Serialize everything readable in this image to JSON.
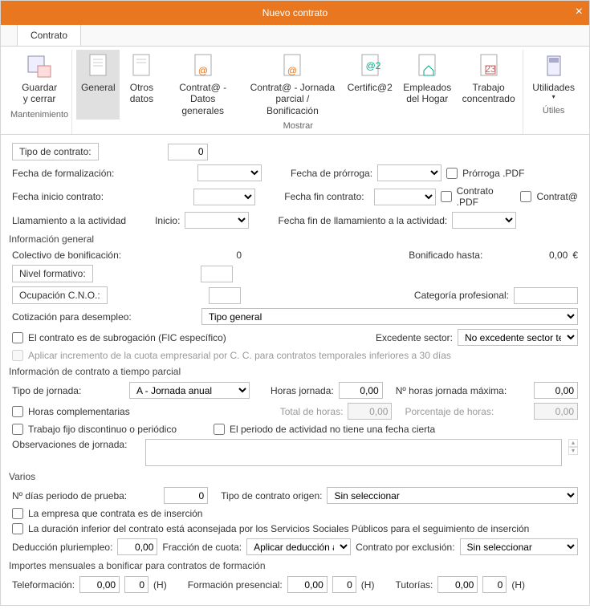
{
  "title": "Nuevo contrato",
  "tab": "Contrato",
  "ribbon": {
    "g1": {
      "label": "Mantenimiento",
      "b1": "Guardar\ny cerrar"
    },
    "g2": {
      "label": "Mostrar",
      "b1": "General",
      "b2": "Otros\ndatos",
      "b3": "Contrat@ -\nDatos generales",
      "b4": "Contrat@ - Jornada\nparcial / Bonificación",
      "b5": "Certific@2",
      "b6": "Empleados\ndel Hogar",
      "b7": "Trabajo\nconcentrado"
    },
    "g3": {
      "label": "Útiles",
      "b1": "Utilidades"
    }
  },
  "f": {
    "tipo_contrato_l": "Tipo de contrato:",
    "tipo_contrato_v": "0",
    "fecha_form_l": "Fecha de formalización:",
    "fecha_ini_l": "Fecha inicio contrato:",
    "llam_l": "Llamamiento a la actividad",
    "inicio_l": "Inicio:",
    "fecha_pro_l": "Fecha de prórroga:",
    "prorroga_pdf": "Prórroga .PDF",
    "fecha_fin_l": "Fecha fin contrato:",
    "contrato_pdf": "Contrato .PDF",
    "contrata": "Contrat@",
    "fecha_fin_llam_l": "Fecha fin de llamamiento a la actividad:",
    "sec_info": "Información general",
    "colec_l": "Colectivo de bonificación:",
    "colec_v": "0",
    "bonif_l": "Bonificado hasta:",
    "bonif_v": "0,00",
    "eur": "€",
    "nivel_l": "Nivel formativo:",
    "ocup_l": "Ocupación C.N.O.:",
    "cat_l": "Categoría profesional:",
    "cotiz_l": "Cotización para desempleo:",
    "cotiz_v": "Tipo general",
    "subrog": "El contrato es de subrogación (FIC específico)",
    "exced_l": "Excedente sector:",
    "exced_v": "No excedente sector tex",
    "incr": "Aplicar incremento de la cuota empresarial por C. C. para contratos temporales inferiores a 30 días",
    "sec_parcial": "Información de contrato a tiempo parcial",
    "tipo_j_l": "Tipo de jornada:",
    "tipo_j_v": "A - Jornada anual",
    "horas_j_l": "Horas jornada:",
    "horas_j_v": "0,00",
    "max_l": "Nº horas jornada máxima:",
    "max_v": "0,00",
    "comp": "Horas complementarias",
    "total_l": "Total de horas:",
    "total_v": "0,00",
    "pct_l": "Porcentaje de horas:",
    "pct_v": "0,00",
    "fijo": "Trabajo fijo discontinuo o periódico",
    "periodo": "El periodo de actividad no tiene una fecha cierta",
    "obs_l": "Observaciones de jornada:",
    "sec_varios": "Varios",
    "dias_l": "Nº días periodo de prueba:",
    "dias_v": "0",
    "origen_l": "Tipo de contrato origen:",
    "origen_v": "Sin seleccionar",
    "ins": "La empresa que contrata es de inserción",
    "dur": "La duración inferior del contrato está aconsejada por los Servicios Sociales Públicos para el seguimiento de inserción",
    "ded_l": "Deducción pluriempleo:",
    "ded_v": "0,00",
    "frac_l": "Fracción de cuota:",
    "frac_v": "Aplicar deducción a",
    "excl_l": "Contrato por exclusión:",
    "excl_v": "Sin seleccionar",
    "sec_imp": "Importes mensuales a bonificar para contratos de formación",
    "tele_l": "Teleformación:",
    "tele_v": "0,00",
    "tele_n": "0",
    "pres_l": "Formación presencial:",
    "pres_v": "0,00",
    "pres_n": "0",
    "tut_l": "Tutorías:",
    "tut_v": "0,00",
    "tut_n": "0",
    "h": "(H)"
  }
}
